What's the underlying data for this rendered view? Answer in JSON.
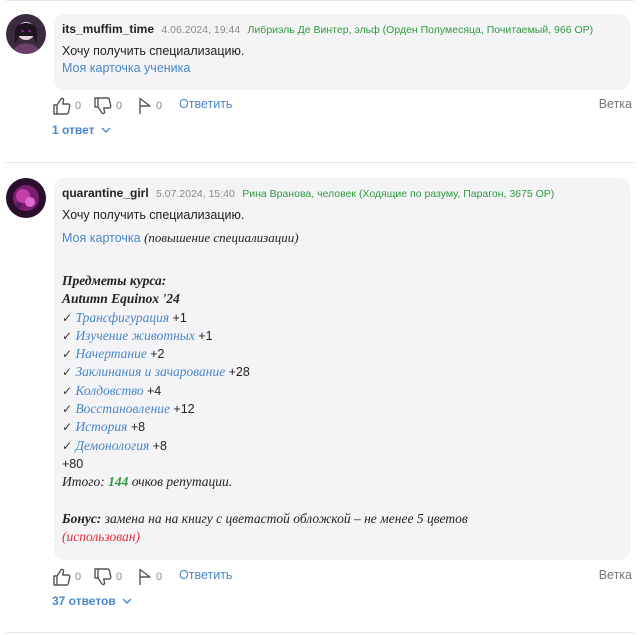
{
  "posts": [
    {
      "username": "its_muffim_time",
      "date": "4.06.2024, 19:44",
      "character": "Либриэль Де Винтер, эльф (Орден Полумесяца, Почитаемый, 966 ОР)",
      "text": "Хочу получить специализацию.",
      "link": "Моя карточка ученика",
      "likes": "0",
      "dislikes": "0",
      "flags": "0",
      "reply_label": "Ответить",
      "thread_label": "Ветка",
      "answers_label": "1 ответ"
    },
    {
      "username": "quarantine_girl",
      "date": "5.07.2024, 15:40",
      "character": "Рина Вранова, человек (Ходящие по разуму, Парагон, 3675 ОР)",
      "text": "Хочу получить специализацию.",
      "link": "Моя карточка",
      "link_note": "(повышение специализации)",
      "course_title": "Предметы курса:",
      "course_name": "Autumn Equinox '24",
      "check": "✓",
      "subjects": [
        {
          "name": "Трансфигурация",
          "points": "+1"
        },
        {
          "name": "Изучение животных",
          "points": "+1"
        },
        {
          "name": "Начертание",
          "points": "+2"
        },
        {
          "name": "Заклинания и зачарование",
          "points": "+28"
        },
        {
          "name": "Колдовство",
          "points": "+4"
        },
        {
          "name": "Восстановление",
          "points": "+12"
        },
        {
          "name": "История",
          "points": "+8"
        },
        {
          "name": "Демонология",
          "points": "+8"
        }
      ],
      "extra": "+80",
      "total_prefix": "Итого:",
      "total_value": "144",
      "total_suffix": "очков репутации.",
      "bonus_label": "Бонус:",
      "bonus_text": "замена на на книгу с цветастой обложкой – не менее 5 цветов",
      "bonus_status": "(использован)",
      "likes": "0",
      "dislikes": "0",
      "flags": "0",
      "reply_label": "Ответить",
      "thread_label": "Ветка",
      "answers_label": "37 ответов"
    }
  ],
  "colors": {
    "accent": "#4a86c8",
    "green": "#2e9b3e",
    "red": "#e0303a",
    "bubble": "#f4f4f6"
  }
}
